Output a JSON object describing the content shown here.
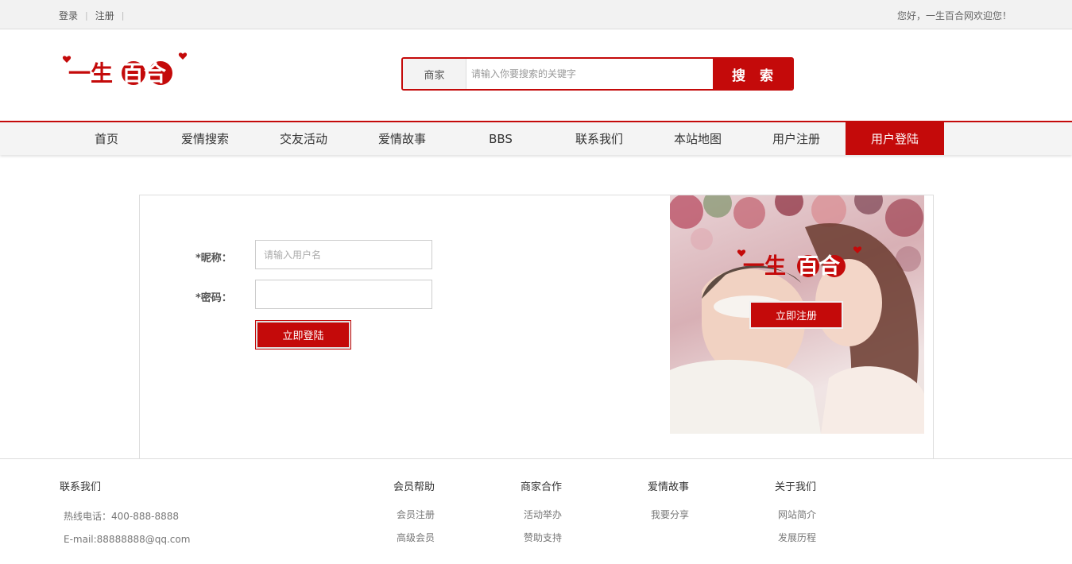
{
  "topbar": {
    "login_link": "登录",
    "register_link": "注册",
    "welcome": "您好，一生百合网欢迎您！"
  },
  "logo": {
    "text": "一生百合"
  },
  "search": {
    "category": "商家",
    "placeholder": "请输入你要搜索的关键字",
    "button": "搜 索"
  },
  "nav": {
    "items": [
      {
        "label": "首页"
      },
      {
        "label": "爱情搜索"
      },
      {
        "label": "交友活动"
      },
      {
        "label": "爱情故事"
      },
      {
        "label": "BBS"
      },
      {
        "label": "联系我们"
      },
      {
        "label": "本站地图"
      },
      {
        "label": "用户注册"
      },
      {
        "label": "用户登陆"
      }
    ],
    "active_index": 8
  },
  "login_form": {
    "nickname_label": "*昵称：",
    "nickname_placeholder": "请输入用户名",
    "password_label": "*密码：",
    "password_value": "",
    "submit": "立即登陆"
  },
  "promo": {
    "logo_text": "一生百合",
    "register_button": "立即注册"
  },
  "footer": {
    "contact": {
      "title": "联系我们",
      "phone": "热线电话：400-888-8888",
      "email": "E-mail:88888888@qq.com"
    },
    "columns": [
      {
        "title": "会员帮助",
        "items": [
          "会员注册",
          "高级会员"
        ]
      },
      {
        "title": "商家合作",
        "items": [
          "活动举办",
          "赞助支持"
        ]
      },
      {
        "title": "爱情故事",
        "items": [
          "我要分享"
        ]
      },
      {
        "title": "关于我们",
        "items": [
          "网站简介",
          "发展历程"
        ]
      }
    ]
  },
  "colors": {
    "brand": "#c40a0a",
    "topbar_bg": "#f2f2f2",
    "nav_bg": "#f4f4f4"
  }
}
